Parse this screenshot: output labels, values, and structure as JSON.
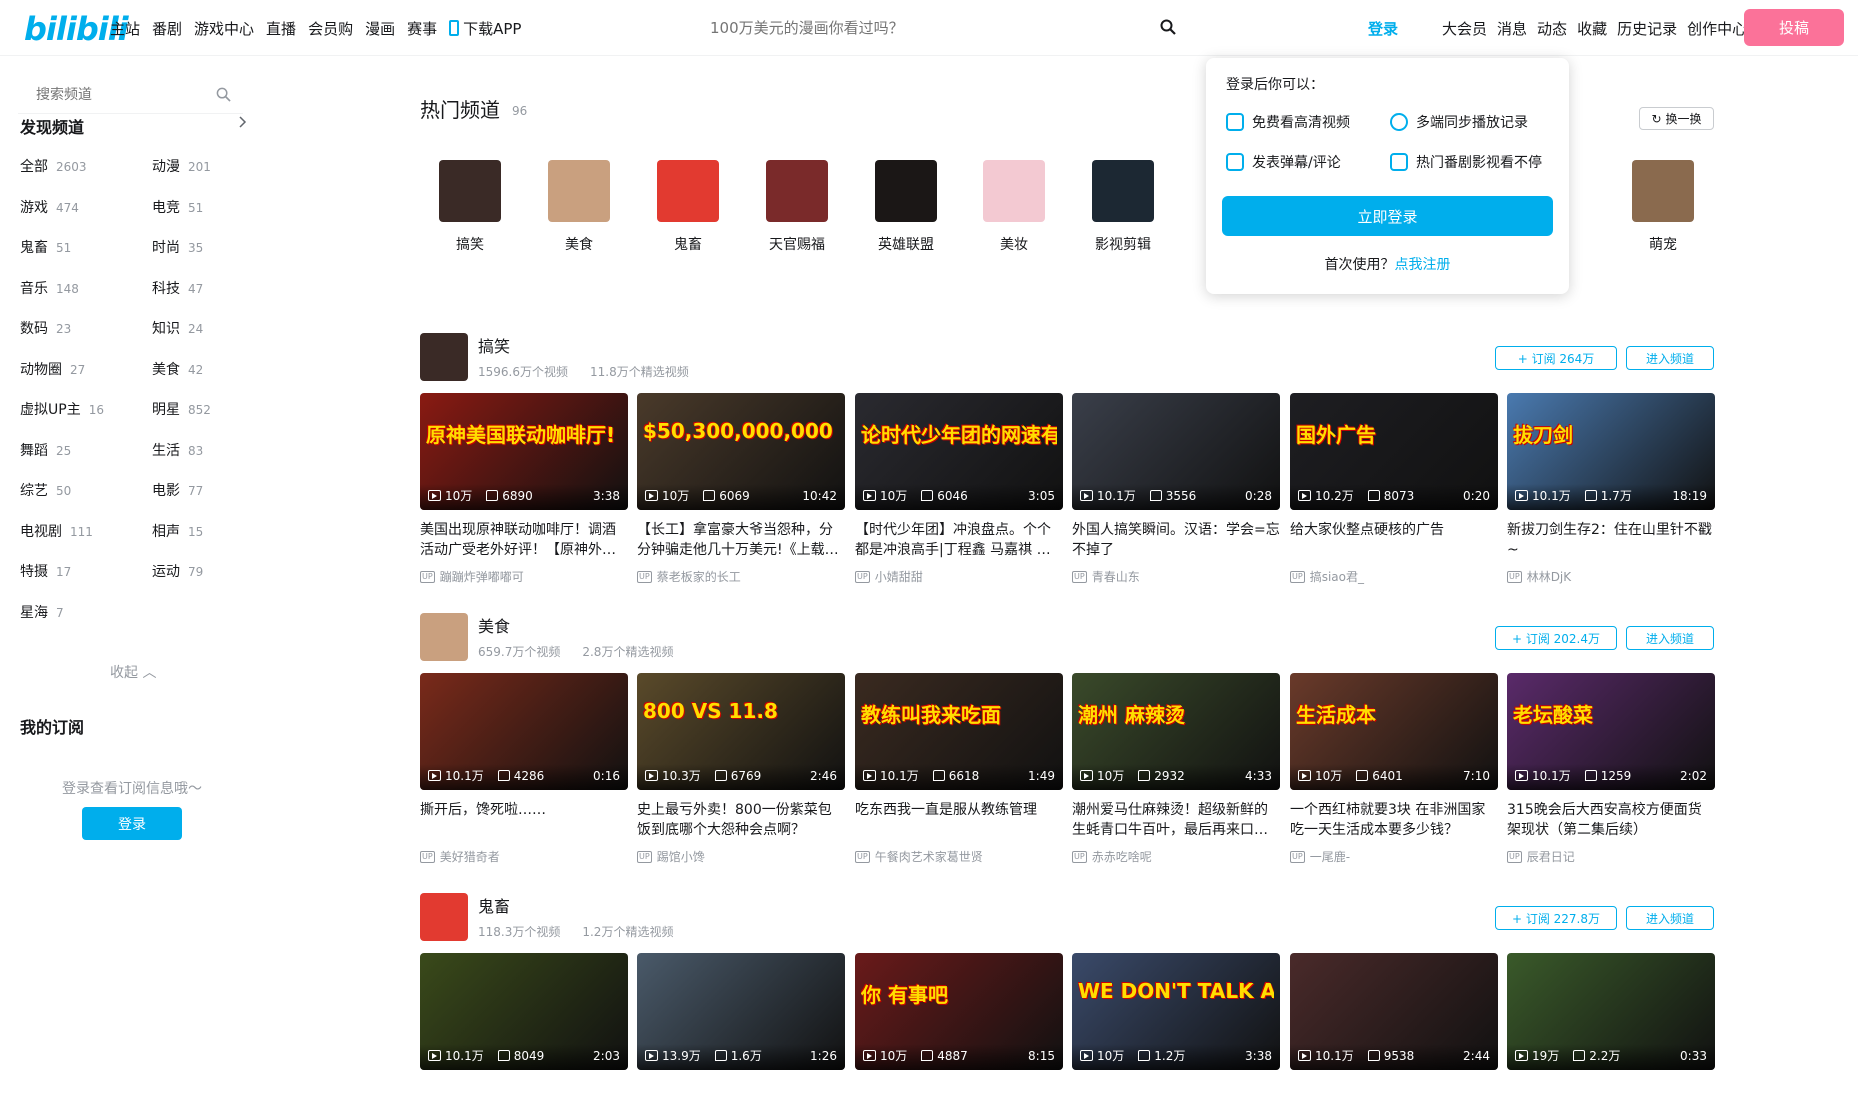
{
  "header": {
    "logo": "bilibili",
    "nav": [
      "主站",
      "番剧",
      "游戏中心",
      "直播",
      "会员购",
      "漫画",
      "赛事"
    ],
    "download_app": "下载APP",
    "search_placeholder": "100万美元的漫画你看过吗？",
    "login": "登录",
    "right_nav": [
      "大会员",
      "消息",
      "动态",
      "收藏",
      "历史记录",
      "创作中心"
    ],
    "upload": "投稿"
  },
  "sidebar": {
    "search_placeholder": "搜索频道",
    "discover": "发现频道",
    "categories": [
      {
        "name": "全部",
        "count": "2603"
      },
      {
        "name": "动漫",
        "count": "201"
      },
      {
        "name": "游戏",
        "count": "474"
      },
      {
        "name": "电竞",
        "count": "51"
      },
      {
        "name": "鬼畜",
        "count": "51"
      },
      {
        "name": "时尚",
        "count": "35"
      },
      {
        "name": "音乐",
        "count": "148"
      },
      {
        "name": "科技",
        "count": "47"
      },
      {
        "name": "数码",
        "count": "23"
      },
      {
        "name": "知识",
        "count": "24"
      },
      {
        "name": "动物圈",
        "count": "27"
      },
      {
        "name": "美食",
        "count": "42"
      },
      {
        "name": "虚拟UP主",
        "count": "16"
      },
      {
        "name": "明星",
        "count": "852"
      },
      {
        "name": "舞蹈",
        "count": "25"
      },
      {
        "name": "生活",
        "count": "83"
      },
      {
        "name": "综艺",
        "count": "50"
      },
      {
        "name": "电影",
        "count": "77"
      },
      {
        "name": "电视剧",
        "count": "111"
      },
      {
        "name": "相声",
        "count": "15"
      },
      {
        "name": "特摄",
        "count": "17"
      },
      {
        "name": "运动",
        "count": "79"
      },
      {
        "name": "星海",
        "count": "7"
      }
    ],
    "collapse": "收起",
    "my_subs": "我的订阅",
    "sub_hint": "登录查看订阅信息哦～",
    "login": "登录"
  },
  "hot": {
    "title": "热门频道",
    "count": "96",
    "refresh": "换一换",
    "channels": [
      {
        "name": "搞笑",
        "color": "#3a2a26"
      },
      {
        "name": "美食",
        "color": "#c9a07f"
      },
      {
        "name": "鬼畜",
        "color": "#e23a30"
      },
      {
        "name": "天官赐福",
        "color": "#7a2a2a"
      },
      {
        "name": "英雄联盟",
        "color": "#1b1716"
      },
      {
        "name": "美妆",
        "color": "#f3c9d2"
      },
      {
        "name": "影视剪辑",
        "color": "#1c2833"
      },
      {
        "name": "萌宠",
        "color": "#8a6a4e"
      }
    ]
  },
  "popover": {
    "title": "登录后你可以：",
    "features": [
      "免费看高清视频",
      "多端同步播放记录",
      "发表弹幕/评论",
      "热门番剧影视看不停"
    ],
    "login": "立即登录",
    "first_use": "首次使用？",
    "register": "点我注册"
  },
  "sections": [
    {
      "name": "搞笑",
      "videos_stat": "1596.6万个视频",
      "featured_stat": "11.8万个精选视频",
      "subscribe": "+ 订阅 264万",
      "enter": "进入频道",
      "avatar_color": "#3a2a26",
      "videos": [
        {
          "caption": "原神美国联动咖啡厅!",
          "color": "#8a1a12",
          "play": "10万",
          "like": "6890",
          "duration": "3:38",
          "title": "美国出现原神联动咖啡厅！调酒活动广受老外好评！【原神外…",
          "up": "蹦蹦炸弹嘟嘟可"
        },
        {
          "caption": "$50,300,000,000",
          "color": "#4a3a2a",
          "play": "10万",
          "like": "6069",
          "duration": "10:42",
          "title": "【长工】拿富豪大爷当怨种，分分钟骗走他几十万美元!《上载…",
          "up": "蔡老板家的长工"
        },
        {
          "caption": "论时代少年团的网速有多快",
          "color": "#2a2a30",
          "play": "10万",
          "like": "6046",
          "duration": "3:05",
          "title": "【时代少年团】冲浪盘点。个个都是冲浪高手|丁程鑫 马嘉祺 …",
          "up": "小婧甜甜"
        },
        {
          "caption": "",
          "color": "#3a3f4a",
          "play": "10.1万",
          "like": "3556",
          "duration": "0:28",
          "title": "外国人搞笑瞬间。汉语：学会=忘不掉了",
          "up": "青春山东"
        },
        {
          "caption": "国外广告",
          "color": "#1e1e22",
          "play": "10.2万",
          "like": "8073",
          "duration": "0:20",
          "title": "给大家伙整点硬核的广告",
          "up": "搞siao君_"
        },
        {
          "caption": "拔刀剑",
          "color": "#4a7ab0",
          "play": "10.1万",
          "like": "1.7万",
          "duration": "18:19",
          "title": "新拔刀剑生存2：住在山里针不戳~",
          "up": "林林DjK"
        }
      ]
    },
    {
      "name": "美食",
      "videos_stat": "659.7万个视频",
      "featured_stat": "2.8万个精选视频",
      "subscribe": "+ 订阅 202.4万",
      "enter": "进入频道",
      "avatar_color": "#c9a07f",
      "videos": [
        {
          "caption": "",
          "color": "#7a2a1a",
          "play": "10.1万",
          "like": "4286",
          "duration": "0:16",
          "title": "撕开后，馋死啦……",
          "up": "美好猎奇者"
        },
        {
          "caption": "800 VS 11.8",
          "color": "#5a4a2a",
          "play": "10.3万",
          "like": "6769",
          "duration": "2:46",
          "title": "史上最亏外卖！800一份紫菜包饭到底哪个大怨种会点啊？",
          "up": "踢馆小馋"
        },
        {
          "caption": "教练叫我来吃面",
          "color": "#3a2a20",
          "play": "10.1万",
          "like": "6618",
          "duration": "1:49",
          "title": "吃东西我一直是服从教练管理",
          "up": "午餐肉艺术家葛世贤"
        },
        {
          "caption": "潮州 麻辣烫",
          "color": "#3a4a2a",
          "play": "10万",
          "like": "2932",
          "duration": "4:33",
          "title": "潮州爱马仕麻辣烫！超级新鲜的生蚝青口牛百叶，最后再来口…",
          "up": "赤赤吃啥呢"
        },
        {
          "caption": "生活成本",
          "color": "#6a3a2a",
          "play": "10万",
          "like": "6401",
          "duration": "7:10",
          "title": "一个西红柿就要3块 在非洲国家吃一天生活成本要多少钱？",
          "up": "一尾鹿-"
        },
        {
          "caption": "老坛酸菜",
          "color": "#5a2a6a",
          "play": "10.1万",
          "like": "1259",
          "duration": "2:02",
          "title": "315晚会后大西安高校方便面货架现状（第二集后续）",
          "up": "辰君日记"
        }
      ]
    },
    {
      "name": "鬼畜",
      "videos_stat": "118.3万个视频",
      "featured_stat": "1.2万个精选视频",
      "subscribe": "+ 订阅 227.8万",
      "enter": "进入频道",
      "avatar_color": "#e23a30",
      "videos": [
        {
          "caption": "",
          "color": "#3a4a1a",
          "play": "10.1万",
          "like": "8049",
          "duration": "2:03",
          "title": "",
          "up": ""
        },
        {
          "caption": "",
          "color": "#4a5a6a",
          "play": "13.9万",
          "like": "1.6万",
          "duration": "1:26",
          "title": "",
          "up": ""
        },
        {
          "caption": "你 有事吧",
          "color": "#6a1a1a",
          "play": "10万",
          "like": "4887",
          "duration": "8:15",
          "title": "",
          "up": ""
        },
        {
          "caption": "WE DON'T TALK ABOUT SLEEPY JOE",
          "color": "#3a4a6a",
          "play": "10万",
          "like": "1.2万",
          "duration": "3:38",
          "title": "",
          "up": ""
        },
        {
          "caption": "",
          "color": "#4a2a2a",
          "play": "10.1万",
          "like": "9538",
          "duration": "2:44",
          "title": "",
          "up": ""
        },
        {
          "caption": "",
          "color": "#3a5a2a",
          "play": "19万",
          "like": "2.2万",
          "duration": "0:33",
          "title": "",
          "up": ""
        }
      ]
    }
  ]
}
